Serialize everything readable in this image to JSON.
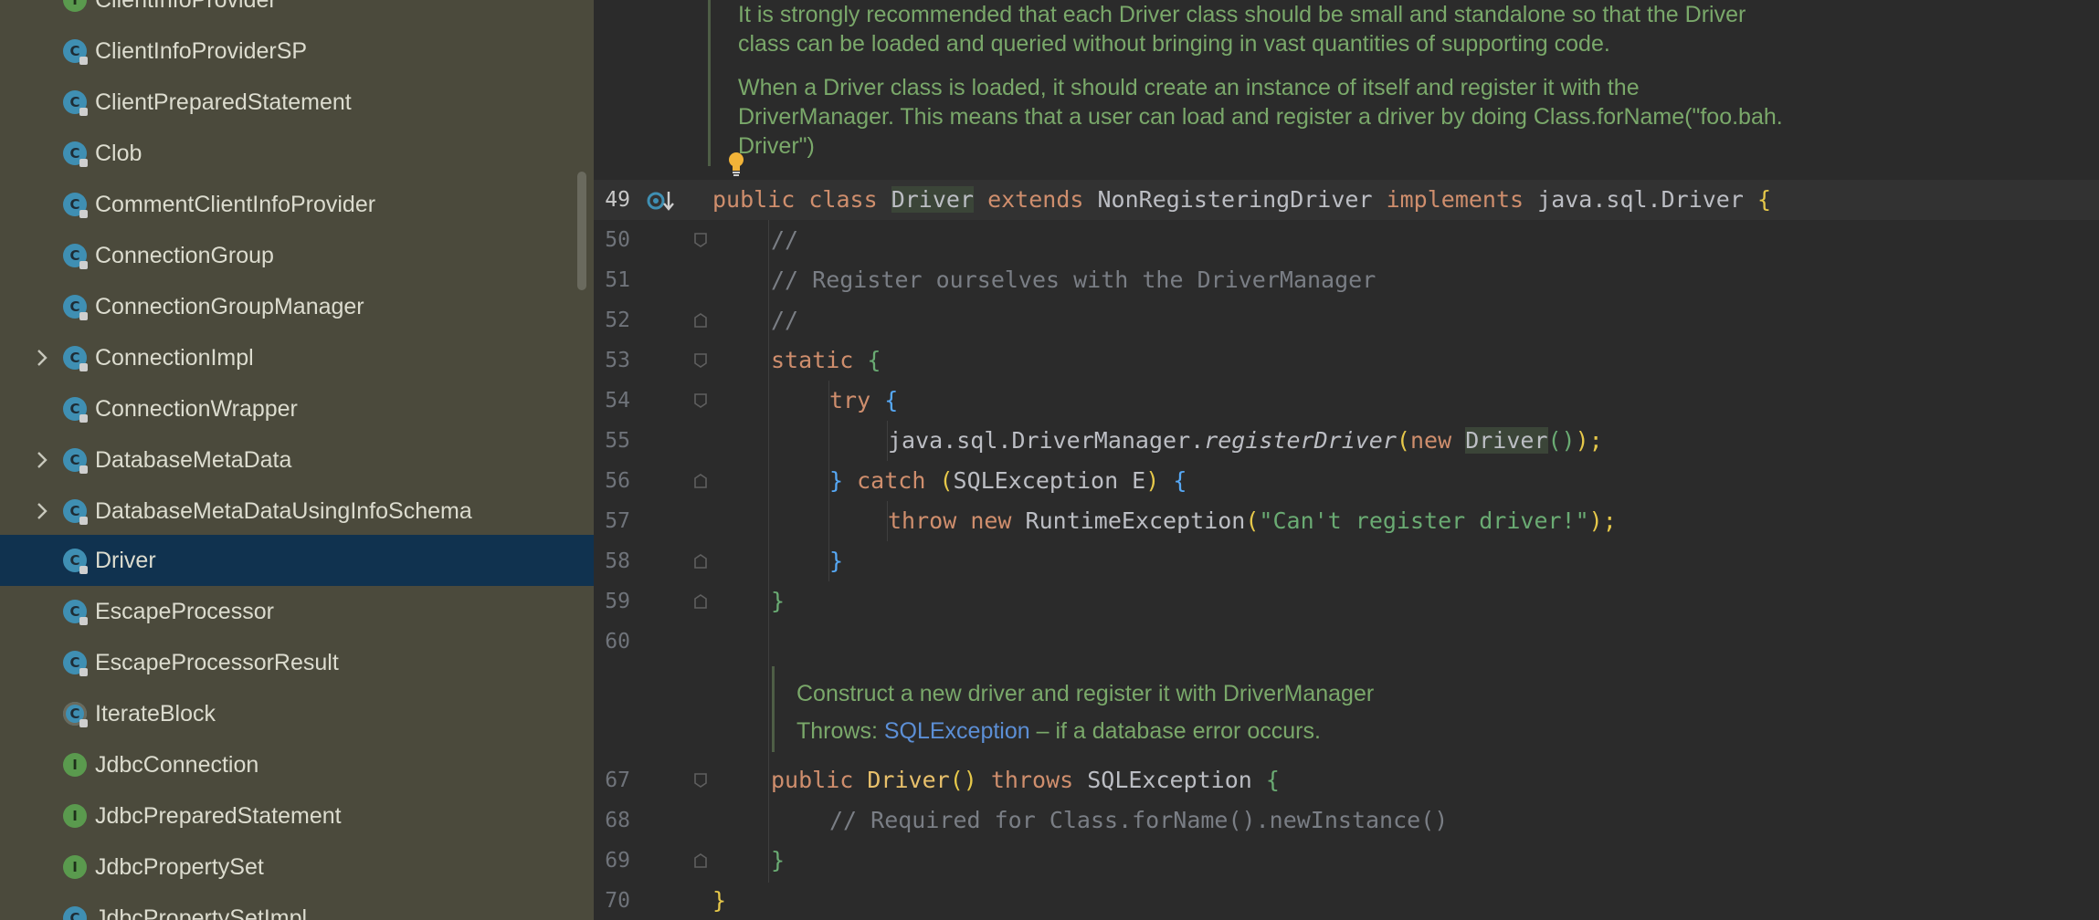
{
  "sidebar": {
    "items": [
      {
        "label": "ClientInfoProvider",
        "icon": "interface",
        "expandable": false,
        "selected": false
      },
      {
        "label": "ClientInfoProviderSP",
        "icon": "class",
        "expandable": false,
        "selected": false
      },
      {
        "label": "ClientPreparedStatement",
        "icon": "class",
        "expandable": false,
        "selected": false
      },
      {
        "label": "Clob",
        "icon": "class",
        "expandable": false,
        "selected": false
      },
      {
        "label": "CommentClientInfoProvider",
        "icon": "class",
        "expandable": false,
        "selected": false
      },
      {
        "label": "ConnectionGroup",
        "icon": "class",
        "expandable": false,
        "selected": false
      },
      {
        "label": "ConnectionGroupManager",
        "icon": "class",
        "expandable": false,
        "selected": false
      },
      {
        "label": "ConnectionImpl",
        "icon": "class",
        "expandable": true,
        "selected": false
      },
      {
        "label": "ConnectionWrapper",
        "icon": "class",
        "expandable": false,
        "selected": false
      },
      {
        "label": "DatabaseMetaData",
        "icon": "class",
        "expandable": true,
        "selected": false
      },
      {
        "label": "DatabaseMetaDataUsingInfoSchema",
        "icon": "class",
        "expandable": true,
        "selected": false
      },
      {
        "label": "Driver",
        "icon": "class",
        "expandable": false,
        "selected": true
      },
      {
        "label": "EscapeProcessor",
        "icon": "class",
        "expandable": false,
        "selected": false
      },
      {
        "label": "EscapeProcessorResult",
        "icon": "class",
        "expandable": false,
        "selected": false
      },
      {
        "label": "IterateBlock",
        "icon": "abstract",
        "expandable": false,
        "selected": false
      },
      {
        "label": "JdbcConnection",
        "icon": "interface",
        "expandable": false,
        "selected": false
      },
      {
        "label": "JdbcPreparedStatement",
        "icon": "interface",
        "expandable": false,
        "selected": false
      },
      {
        "label": "JdbcPropertySet",
        "icon": "interface",
        "expandable": false,
        "selected": false
      },
      {
        "label": "JdbcPropertySetImpl",
        "icon": "class",
        "expandable": false,
        "selected": false
      }
    ]
  },
  "editor": {
    "doc_top": {
      "p1_l1": "It is strongly recommended that each Driver class should be small and standalone so that the Driver",
      "p1_l2": "class can be loaded and queried without bringing in vast quantities of supporting code.",
      "p2_l1": "When a Driver class is loaded, it should create an instance of itself and register it with the",
      "p2_l2": "DriverManager. This means that a user can load and register a driver by doing Class.forName(\"foo.bah.",
      "p2_l3": "Driver\")"
    },
    "doc_mid": {
      "line1": "Construct a new driver and register it with DriverManager",
      "throws_label": "Throws:",
      "throws_link": "SQLException",
      "throws_rest": " – if a database error occurs."
    },
    "lines": {
      "l49": {
        "num": "49",
        "t1": "public",
        "t2": " ",
        "t3": "class",
        "t4": " ",
        "t5": "Driver",
        "t6": " ",
        "t7": "extends",
        "t8": " NonRegisteringDriver ",
        "t9": "implements",
        "t10": " java.sql.Driver ",
        "t11": "{"
      },
      "l50": {
        "num": "50",
        "text": "//"
      },
      "l51": {
        "num": "51",
        "text": "// Register ourselves with the DriverManager"
      },
      "l52": {
        "num": "52",
        "text": "//"
      },
      "l53": {
        "num": "53",
        "kw": "static",
        "brace": "{"
      },
      "l54": {
        "num": "54",
        "kw": "try",
        "brace": "{"
      },
      "l55": {
        "num": "55",
        "t1": "java.sql.DriverManager.",
        "t2": "registerDriver",
        "t3": "(",
        "t4": "new",
        "t5": " ",
        "t6": "Driver",
        "t7": "()",
        "t8": ");"
      },
      "l56": {
        "num": "56",
        "t1": "}",
        "t2": " ",
        "t3": "catch",
        "t4": " ",
        "t5": "(",
        "t6": "SQLException E",
        "t7": ")",
        "t8": " ",
        "t9": "{"
      },
      "l57": {
        "num": "57",
        "t1": "throw",
        "t2": " ",
        "t3": "new",
        "t4": " RuntimeException",
        "t5": "(",
        "t6": "\"Can't register driver!\"",
        "t7": ");"
      },
      "l58": {
        "num": "58",
        "brace": "}"
      },
      "l59": {
        "num": "59",
        "brace": "}"
      },
      "l60": {
        "num": "60"
      },
      "l67": {
        "num": "67",
        "t1": "public",
        "t2": " ",
        "t3": "Driver",
        "t4": "()",
        "t5": " ",
        "t6": "throws",
        "t7": " SQLException ",
        "t8": "{"
      },
      "l68": {
        "num": "68",
        "text": "// Required for Class.forName().newInstance()"
      },
      "l69": {
        "num": "69",
        "brace": "}"
      },
      "l70": {
        "num": "70",
        "brace": "}"
      }
    }
  },
  "colors": {
    "sidebar_bg": "#4b4a3c",
    "selection": "#10324f",
    "editor_bg": "#2b2b2b",
    "keyword": "#cf8e6d",
    "comment": "#7a7e85",
    "string": "#6aab73",
    "doc": "#7aa86a"
  },
  "icons": {
    "class": "class-icon",
    "interface": "interface-icon",
    "expand": "chevron-right-icon",
    "bulb": "lightbulb-icon",
    "gutter": "implementation-icon"
  }
}
